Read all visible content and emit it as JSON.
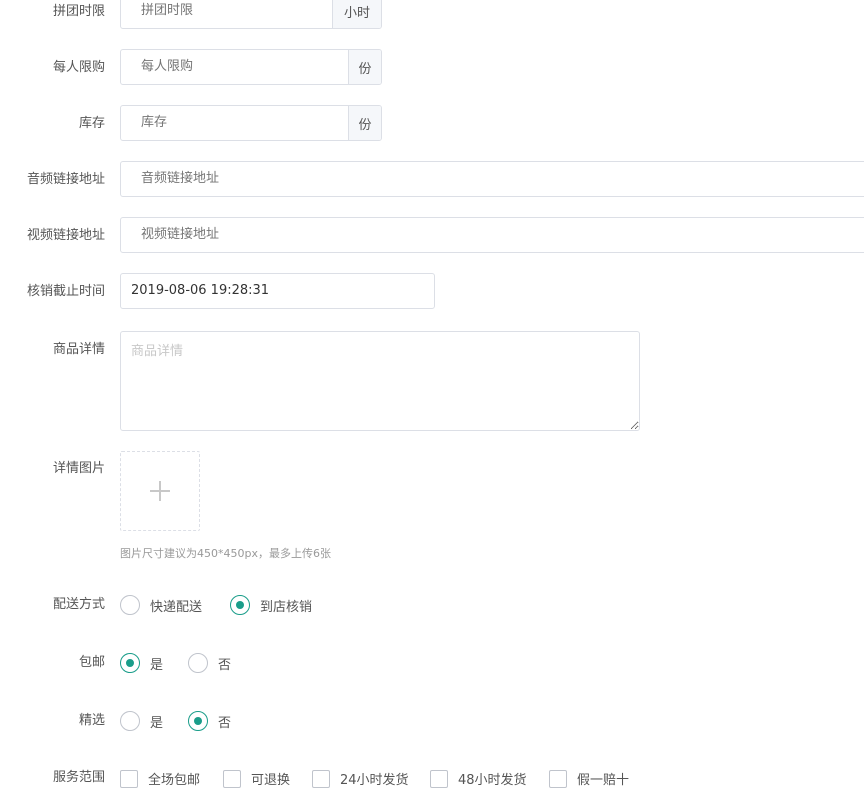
{
  "form": {
    "group_time": {
      "label": "拼团时限",
      "placeholder": "拼团时限",
      "unit": "小时"
    },
    "per_limit": {
      "label": "每人限购",
      "placeholder": "每人限购",
      "unit": "份"
    },
    "stock": {
      "label": "库存",
      "placeholder": "库存",
      "unit": "份"
    },
    "audio_link": {
      "label": "音频链接地址",
      "placeholder": "音频链接地址"
    },
    "video_link": {
      "label": "视频链接地址",
      "placeholder": "视频链接地址"
    },
    "deadline": {
      "label": "核销截止时间",
      "value": "2019-08-06 19:28:31"
    },
    "detail": {
      "label": "商品详情",
      "placeholder": "商品详情"
    },
    "detail_images": {
      "label": "详情图片",
      "upload_icon": "plus-icon",
      "hint": "图片尺寸建议为450*450px，最多上传6张"
    },
    "delivery": {
      "label": "配送方式",
      "options": [
        {
          "label": "快递配送",
          "selected": false
        },
        {
          "label": "到店核销",
          "selected": true
        }
      ]
    },
    "free_shipping": {
      "label": "包邮",
      "options": [
        {
          "label": "是",
          "selected": true
        },
        {
          "label": "否",
          "selected": false
        }
      ]
    },
    "featured": {
      "label": "精选",
      "options": [
        {
          "label": "是",
          "selected": false
        },
        {
          "label": "否",
          "selected": true
        }
      ]
    },
    "service_scope": {
      "label": "服务范围",
      "options": [
        {
          "label": "全场包邮",
          "checked": false
        },
        {
          "label": "可退换",
          "checked": false
        },
        {
          "label": "24小时发货",
          "checked": false
        },
        {
          "label": "48小时发货",
          "checked": false
        },
        {
          "label": "假一赔十",
          "checked": false
        }
      ]
    }
  },
  "colors": {
    "accent": "#1a9d8a",
    "border": "#dcdfe6",
    "addon_bg": "#f5f7fa"
  }
}
